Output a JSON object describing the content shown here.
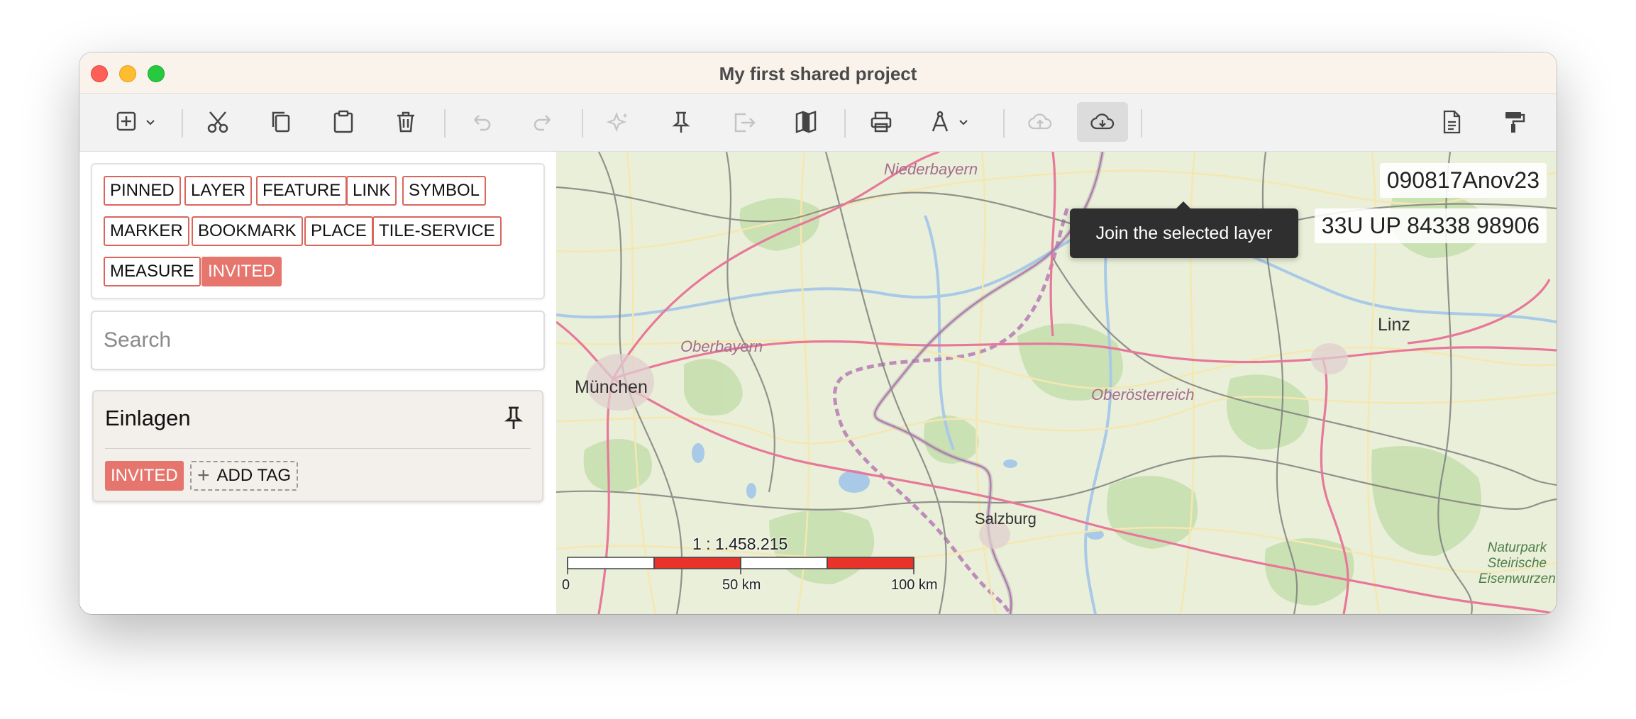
{
  "window": {
    "title": "My first shared project"
  },
  "toolbar": {
    "tooltip": "Join the selected layer",
    "icons": [
      "add-icon",
      "cut-icon",
      "copy-icon",
      "paste-icon",
      "delete-icon",
      "undo-icon",
      "redo-icon",
      "sparkle-icon",
      "pin-icon",
      "export-icon",
      "map-icon",
      "print-icon",
      "measure-tool-icon",
      "cloud-upload-icon",
      "cloud-download-icon",
      "document-icon",
      "paint-roller-icon"
    ]
  },
  "sidebar": {
    "tags": [
      "PINNED",
      "LAYER",
      "FEATURE",
      "LINK",
      "SYMBOL",
      "MARKER",
      "BOOKMARK",
      "PLACE",
      "TILE-SERVICE",
      "MEASURE",
      "INVITED"
    ],
    "selected_tag": "INVITED",
    "search_placeholder": "Search",
    "layer": {
      "name": "Einlagen",
      "tag": "INVITED",
      "add_tag_label": "ADD TAG"
    }
  },
  "map": {
    "labels": {
      "niederbayern": "Niederbayern",
      "oberbayern": "Oberbayern",
      "munchen": "München",
      "linz": "Linz",
      "oberosterreich": "Oberösterreich",
      "salzburg": "Salzburg",
      "naturpark": "Naturpark\nSteirische\nEisenwurzen"
    },
    "dtg": "090817Anov23",
    "mgrs": "33U UP 84338 98906",
    "scale": {
      "ratio": "1 : 1.458.215",
      "tick_0": "0",
      "tick_50": "50 km",
      "tick_100": "100 km"
    }
  },
  "colors": {
    "accent": "#e6766d",
    "tag_border": "#d9665c",
    "scale_red": "#e8322a"
  }
}
